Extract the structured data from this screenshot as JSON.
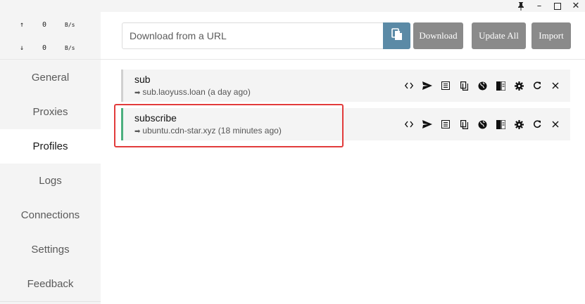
{
  "window": {
    "pin_icon": "pin-icon",
    "minimize_glyph": "–",
    "maximize_glyph": "☐",
    "close_glyph": "✕"
  },
  "traffic": {
    "upload": {
      "arrow": "↑",
      "value": "0",
      "unit": "B/s"
    },
    "download": {
      "arrow": "↓",
      "value": "0",
      "unit": "B/s"
    }
  },
  "sidebar": {
    "items": [
      {
        "label": "General"
      },
      {
        "label": "Proxies"
      },
      {
        "label": "Profiles"
      },
      {
        "label": "Logs"
      },
      {
        "label": "Connections"
      },
      {
        "label": "Settings"
      },
      {
        "label": "Feedback"
      }
    ],
    "active": "Profiles"
  },
  "topbar": {
    "url_placeholder": "Download from a URL",
    "url_value": "",
    "download_label": "Download",
    "update_all_label": "Update All",
    "import_label": "Import"
  },
  "profiles": [
    {
      "name": "sub",
      "url": "sub.laoyuss.loan (a day ago)",
      "selected": false
    },
    {
      "name": "subscribe",
      "url": "ubuntu.cdn-star.xyz (18 minutes ago)",
      "selected": true
    }
  ],
  "profile_actions": [
    "code-icon",
    "send-icon",
    "list-icon",
    "copy-icon",
    "globe-icon",
    "columns-icon",
    "gear-icon",
    "refresh-icon",
    "close-icon"
  ],
  "colors": {
    "accent_selected": "#4caf7f",
    "paste_button": "#5b8aa6",
    "buttons": "#8a8a8a",
    "highlight": "#e23b3b"
  }
}
